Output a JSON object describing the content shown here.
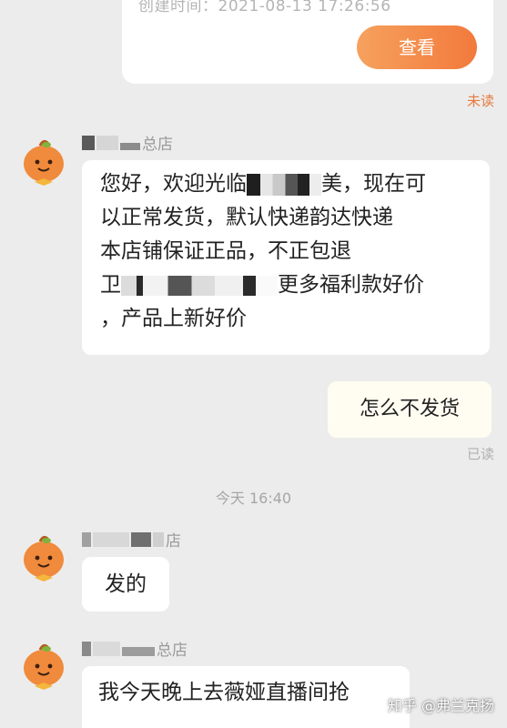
{
  "order_card": {
    "created_text": "创建时间：2021-08-13 17:26:56",
    "view_button": "查看"
  },
  "status": {
    "unread": "未读",
    "read": "已读"
  },
  "messages": [
    {
      "shop_name_suffix": "总店",
      "lines": [
        {
          "before": "您好，欢迎光临",
          "after": "美，现在可"
        },
        {
          "before": "以正常发货，默认快递韵达快递",
          "after": ""
        },
        {
          "before": "本店铺保证正品，不正包退",
          "after": ""
        },
        {
          "before": "卫",
          "after": "更多福利款好价"
        },
        {
          "before": "，产品上新好价",
          "after": ""
        }
      ]
    },
    {
      "text": "怎么不发货"
    },
    {
      "shop_name_suffix": "店",
      "text": "发的"
    },
    {
      "shop_name_suffix": "总店",
      "text": "我今天晚上去薇娅直播间抢"
    }
  ],
  "time_divider": "今天 16:40",
  "watermark": "知乎 @弗兰克扬",
  "colors": {
    "background": "#ececec",
    "accent_orange": "#f27a3c",
    "read_gray": "#b0b0b0",
    "bubble_right": "#fffdf1"
  },
  "icons": [
    "orange-mascot-avatar-icon"
  ]
}
